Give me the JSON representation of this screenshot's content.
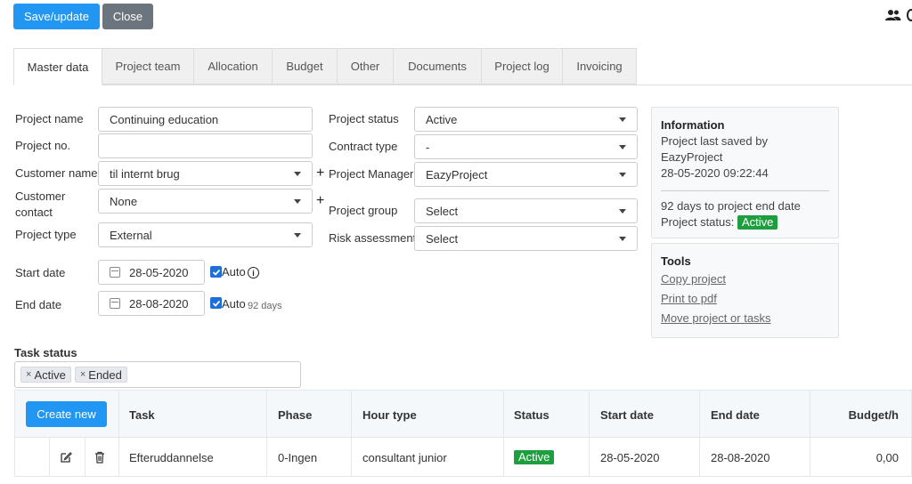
{
  "toolbar": {
    "save_label": "Save/update",
    "close_label": "Close"
  },
  "tabs": [
    {
      "label": "Master data",
      "active": true
    },
    {
      "label": "Project team"
    },
    {
      "label": "Allocation"
    },
    {
      "label": "Budget"
    },
    {
      "label": "Other"
    },
    {
      "label": "Documents"
    },
    {
      "label": "Project log"
    },
    {
      "label": "Invoicing"
    }
  ],
  "form": {
    "project_name_label": "Project name",
    "project_name_value": "Continuing education",
    "project_no_label": "Project no.",
    "project_no_value": "",
    "customer_name_label": "Customer name",
    "customer_name_value": "til internt brug",
    "customer_contact_label_1": "Customer",
    "customer_contact_label_2": "contact",
    "customer_contact_value": "None",
    "project_type_label": "Project type",
    "project_type_value": "External",
    "start_date_label": "Start date",
    "start_date_value": "28-05-2020",
    "end_date_label": "End date",
    "end_date_value": "28-08-2020",
    "auto_label": "Auto",
    "days_label": "92 days",
    "plus": "+",
    "project_status_label": "Project status",
    "project_status_value": "Active",
    "contract_type_label": "Contract type",
    "contract_type_value": "-",
    "project_manager_label": "Project Manager",
    "project_manager_value": "EazyProject",
    "project_group_label": "Project group",
    "project_group_value": "Select",
    "risk_assessment_label": "Risk assessment",
    "risk_assessment_value": "Select"
  },
  "info": {
    "title": "Information",
    "line1": "Project last saved by",
    "line2": "EazyProject",
    "line3": "28-05-2020 09:22:44",
    "line4": "92 days to project end date",
    "status_label": "Project status:",
    "status_value": "Active"
  },
  "tools": {
    "title": "Tools",
    "links": [
      "Copy project",
      "Print to pdf",
      "Move project or tasks"
    ]
  },
  "task_status": {
    "label": "Task status",
    "tags": [
      "Active",
      "Ended"
    ],
    "remove_glyph": "×"
  },
  "grid": {
    "create_label": "Create new",
    "headers": [
      "Task",
      "Phase",
      "Hour type",
      "Status",
      "Start date",
      "End date",
      "Budget/h"
    ],
    "rows": [
      [
        "Efteruddannelse",
        "0-Ingen",
        "consultant junior",
        "Active",
        "28-05-2020",
        "28-08-2020",
        "0,00"
      ]
    ]
  },
  "colors": {
    "primary": "#2196f3",
    "secondary": "#6c757d",
    "active_badge": "#1e9e3e"
  }
}
